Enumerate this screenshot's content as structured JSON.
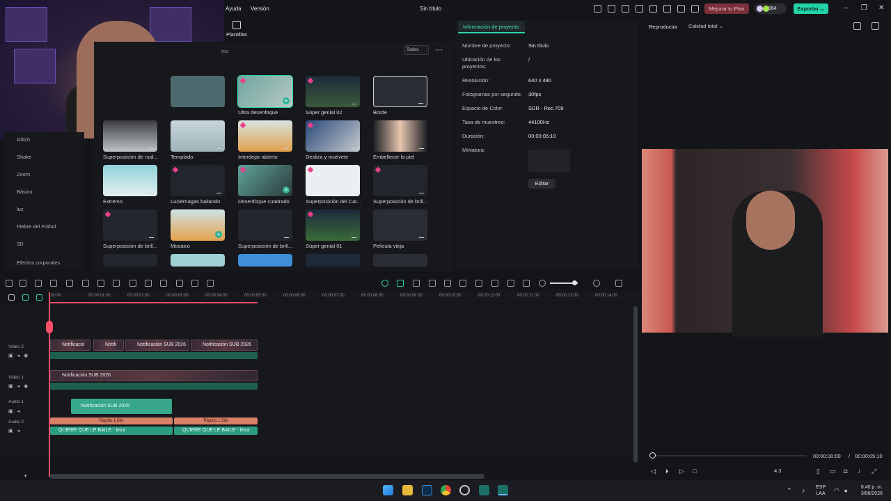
{
  "menu": {
    "help": "Ayuda",
    "version": "Versión"
  },
  "window_title": "Sin título",
  "header": {
    "upgrade": "Mejorar tu Plan",
    "credits": "984",
    "export": "Exportar",
    "brand_color": "#23d3a9",
    "upgrade_color": "#7a2f3b"
  },
  "templates_tab": "Plantillas",
  "library": {
    "filter": "Todos",
    "breadcrumb_tail": "tos",
    "nav_items": [
      "Glitch",
      "Shake",
      "Zoom",
      "Básico",
      "luz",
      "Fiebre del Fútbol",
      "3D",
      "Efectos corporales"
    ],
    "tiles": [
      {
        "label": "Ultra desenfoque",
        "selected": true
      },
      {
        "label": "Súper genial 02"
      },
      {
        "label": "Borde"
      },
      {
        "label": "Superposición de ruid..."
      },
      {
        "label": "Templado"
      },
      {
        "label": "Interdejar abierto"
      },
      {
        "label": "Desliza y muévete"
      },
      {
        "label": "Embellecer la piel"
      },
      {
        "label": "Extremo"
      },
      {
        "label": "Luciérnagas bailando"
      },
      {
        "label": "Desenfoque cuadrado"
      },
      {
        "label": "Superposición del Car..."
      },
      {
        "label": "Superposición de brill..."
      },
      {
        "label": "Superposición de brill..."
      },
      {
        "label": "Mosaico"
      },
      {
        "label": "Superposición de brill..."
      },
      {
        "label": "Súper genial 01"
      },
      {
        "label": "Película vieja"
      }
    ]
  },
  "project_info": {
    "tab": "Información de proyecto",
    "name_label": "Nombre de proyecto:",
    "name": "Sin título",
    "location_label": "Ubicación de los proyectos:",
    "location": "/",
    "resolution_label": "Resolución:",
    "resolution": "640 x 480",
    "fps_label": "Fotogramas por segundo:",
    "fps": "30fps",
    "color_label": "Espacio de Color:",
    "color": "SDR - Rec.709",
    "sample_label": "Tasa de muestreo:",
    "sample": "44100Hz",
    "duration_label": "Duración:",
    "duration": "00:00:05:10",
    "thumb_label": "Miniatura:",
    "edit": "Editar"
  },
  "player": {
    "label": "Reproductor",
    "quality": "Calidad total",
    "current": "00:00:00:00",
    "sep": "/",
    "total": "00:00:05:10",
    "ratio": "4:3"
  },
  "ruler": [
    "00:00",
    "00:00:01:00",
    "00:00:02:00",
    "00:00:03:00",
    "00:00:04:00",
    "00:00:05:00",
    "00:00:06:00",
    "00:00:07:00",
    "00:00:08:00",
    "00:00:09:00",
    "00:00:10:00",
    "00:00:11:00",
    "00:00:12:00",
    "00:00:13:00",
    "00:00:14:00"
  ],
  "tracks": {
    "video2": "Video 2",
    "video1": "Video 1",
    "audio1": "Audio 1",
    "audio2": "Audio 2",
    "v2_clips": [
      "Notificació",
      "Notifi",
      "Notificación SUB 2026",
      "Notificación SUB 2026"
    ],
    "v1_clip": "Notificación SUB 2026",
    "a1_clip": "Notificación SUB 2026",
    "a2_speed": [
      "Rápido 1.58x",
      "Rápido 1.58x"
    ],
    "a2_clips": [
      "QUIERE QUE LE BAILE - letra",
      "QUIERE QUE LE BAILE - letra"
    ]
  },
  "taskbar": {
    "lang": "ESP",
    "lang2": "LAA",
    "time": "8:40 p. m.",
    "date": "3/08/2026"
  }
}
